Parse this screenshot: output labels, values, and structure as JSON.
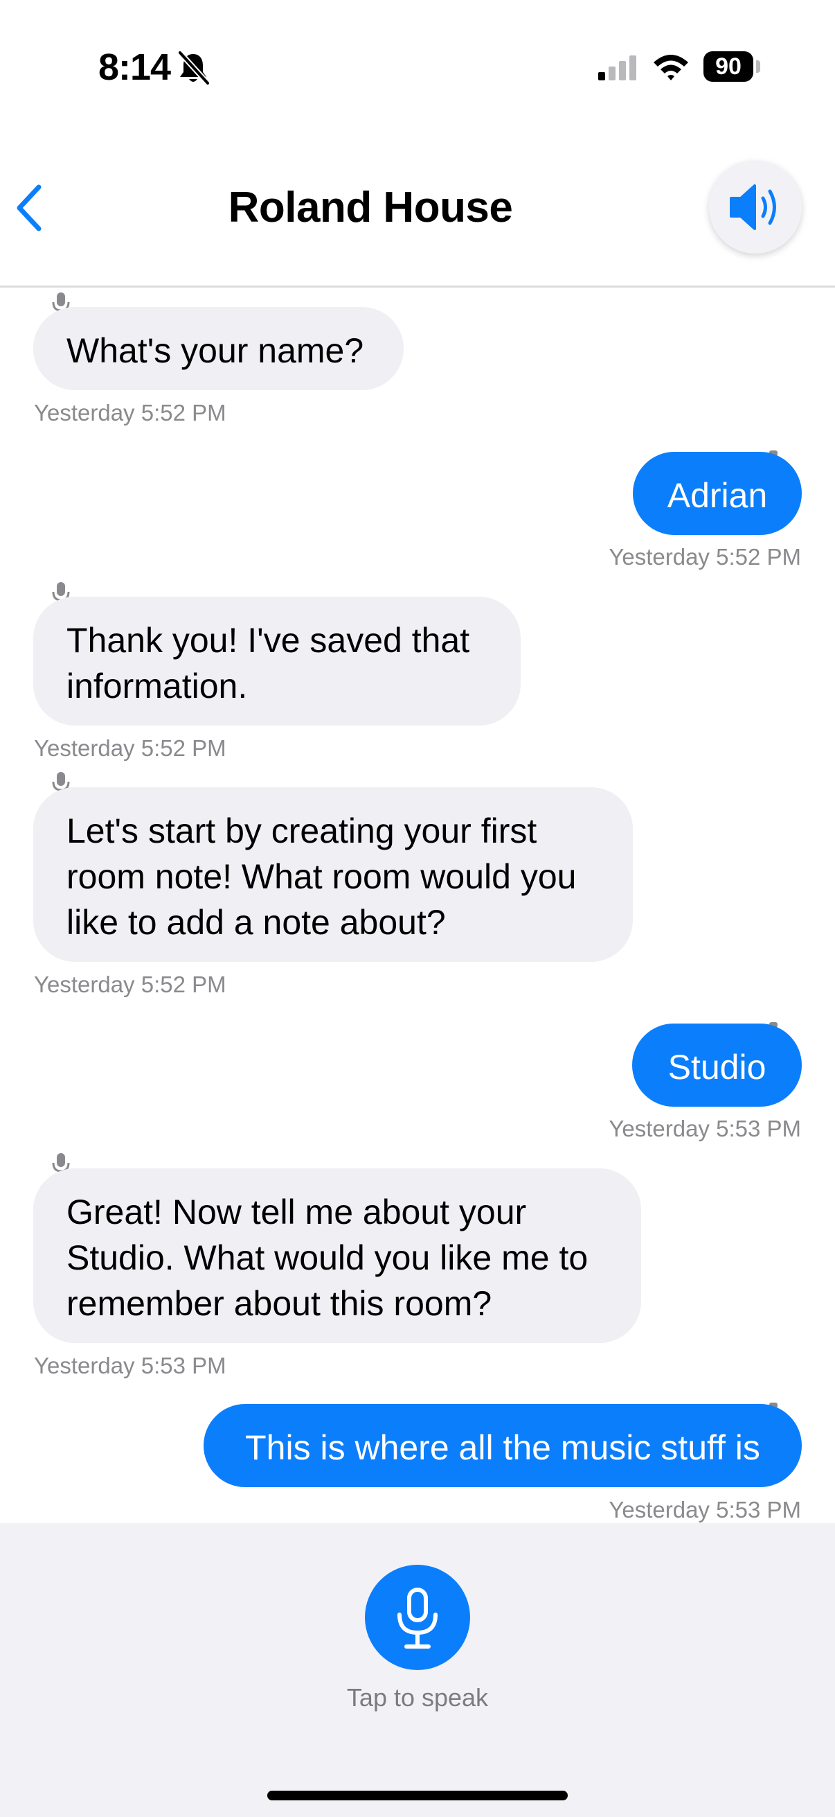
{
  "status_bar": {
    "time": "8:14",
    "battery": "90"
  },
  "header": {
    "title": "Roland House"
  },
  "messages": [
    {
      "sender": "assistant",
      "text": "What's your name?",
      "time": "Yesterday 5:52 PM"
    },
    {
      "sender": "user",
      "text": "Adrian",
      "time": "Yesterday 5:52 PM"
    },
    {
      "sender": "assistant",
      "text": "Thank you! I've saved that information.",
      "time": "Yesterday 5:52 PM"
    },
    {
      "sender": "assistant",
      "text": "Let's start by creating your first room note! What room would you like to add a note about?",
      "time": "Yesterday 5:52 PM"
    },
    {
      "sender": "user",
      "text": "Studio",
      "time": "Yesterday 5:53 PM"
    },
    {
      "sender": "assistant",
      "text": "Great! Now tell me about your Studio. What would you like me to remember about this room?",
      "time": "Yesterday 5:53 PM"
    },
    {
      "sender": "user",
      "text": "This is where all the music stuff is",
      "time": "Yesterday 5:53 PM"
    }
  ],
  "bottom": {
    "hint": "Tap to speak"
  },
  "colors": {
    "accent": "#0b7efc",
    "incoming_bubble": "#efeff4",
    "timestamp": "#8a8a8e"
  }
}
